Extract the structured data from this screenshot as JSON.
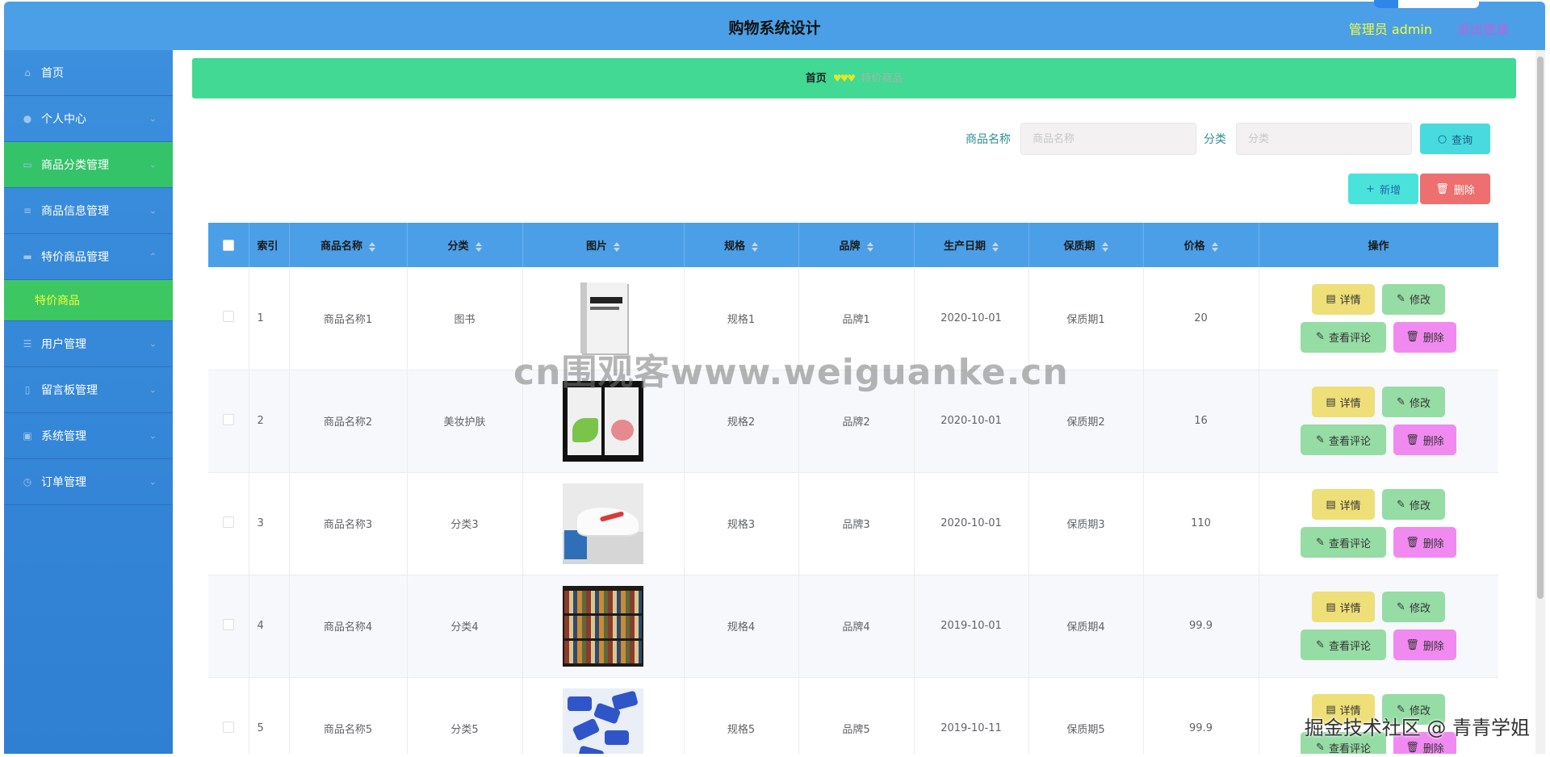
{
  "header": {
    "title": "购物系统设计",
    "user": "管理员 admin",
    "logout": "退出登录"
  },
  "sidebar": {
    "items": [
      {
        "label": "首页",
        "icon": "home-icon"
      },
      {
        "label": "个人中心",
        "icon": "user-icon"
      },
      {
        "label": "商品分类管理",
        "icon": "folder-icon",
        "active": true
      },
      {
        "label": "商品信息管理",
        "icon": "list-icon"
      },
      {
        "label": "特价商品管理",
        "icon": "monitor-icon",
        "expanded": true
      },
      {
        "label": "特价商品",
        "sub": true
      },
      {
        "label": "用户管理",
        "icon": "sliders-icon"
      },
      {
        "label": "留言板管理",
        "icon": "phone-icon"
      },
      {
        "label": "系统管理",
        "icon": "clipboard-icon"
      },
      {
        "label": "订单管理",
        "icon": "clock-icon"
      }
    ]
  },
  "breadcrumb": {
    "home": "首页",
    "separator": "♥♥♥",
    "current": "特价商品"
  },
  "search": {
    "name_label": "商品名称",
    "name_placeholder": "商品名称",
    "category_label": "分类",
    "category_placeholder": "分类",
    "query_button": "查询"
  },
  "actions": {
    "add": "新增",
    "delete": "删除"
  },
  "table": {
    "columns": [
      "索引",
      "商品名称",
      "分类",
      "图片",
      "规格",
      "品牌",
      "生产日期",
      "保质期",
      "价格",
      "操作"
    ],
    "rows": [
      {
        "index": "1",
        "name": "商品名称1",
        "category": "图书",
        "spec": "规格1",
        "brand": "品牌1",
        "date": "2020-10-01",
        "shelf": "保质期1",
        "price": "20",
        "image": "book"
      },
      {
        "index": "2",
        "name": "商品名称2",
        "category": "美妆护肤",
        "spec": "规格2",
        "brand": "品牌2",
        "date": "2020-10-01",
        "shelf": "保质期2",
        "price": "16",
        "image": "mask"
      },
      {
        "index": "3",
        "name": "商品名称3",
        "category": "分类3",
        "spec": "规格3",
        "brand": "品牌3",
        "date": "2020-10-01",
        "shelf": "保质期3",
        "price": "110",
        "image": "shoe"
      },
      {
        "index": "4",
        "name": "商品名称4",
        "category": "分类4",
        "spec": "规格4",
        "brand": "品牌4",
        "date": "2019-10-01",
        "shelf": "保质期4",
        "price": "99.9",
        "image": "shelf"
      },
      {
        "index": "5",
        "name": "商品名称5",
        "category": "分类5",
        "spec": "规格5",
        "brand": "品牌5",
        "date": "2019-10-11",
        "shelf": "保质期5",
        "price": "99.9",
        "image": "candy"
      }
    ],
    "row_actions": {
      "detail": "详情",
      "edit": "修改",
      "comments": "查看评论",
      "delete": "删除"
    }
  },
  "overlays": {
    "watermark": "cn围观客www.weiguanke.cn",
    "footer": "掘金技术社区 @ 青青学姐"
  }
}
